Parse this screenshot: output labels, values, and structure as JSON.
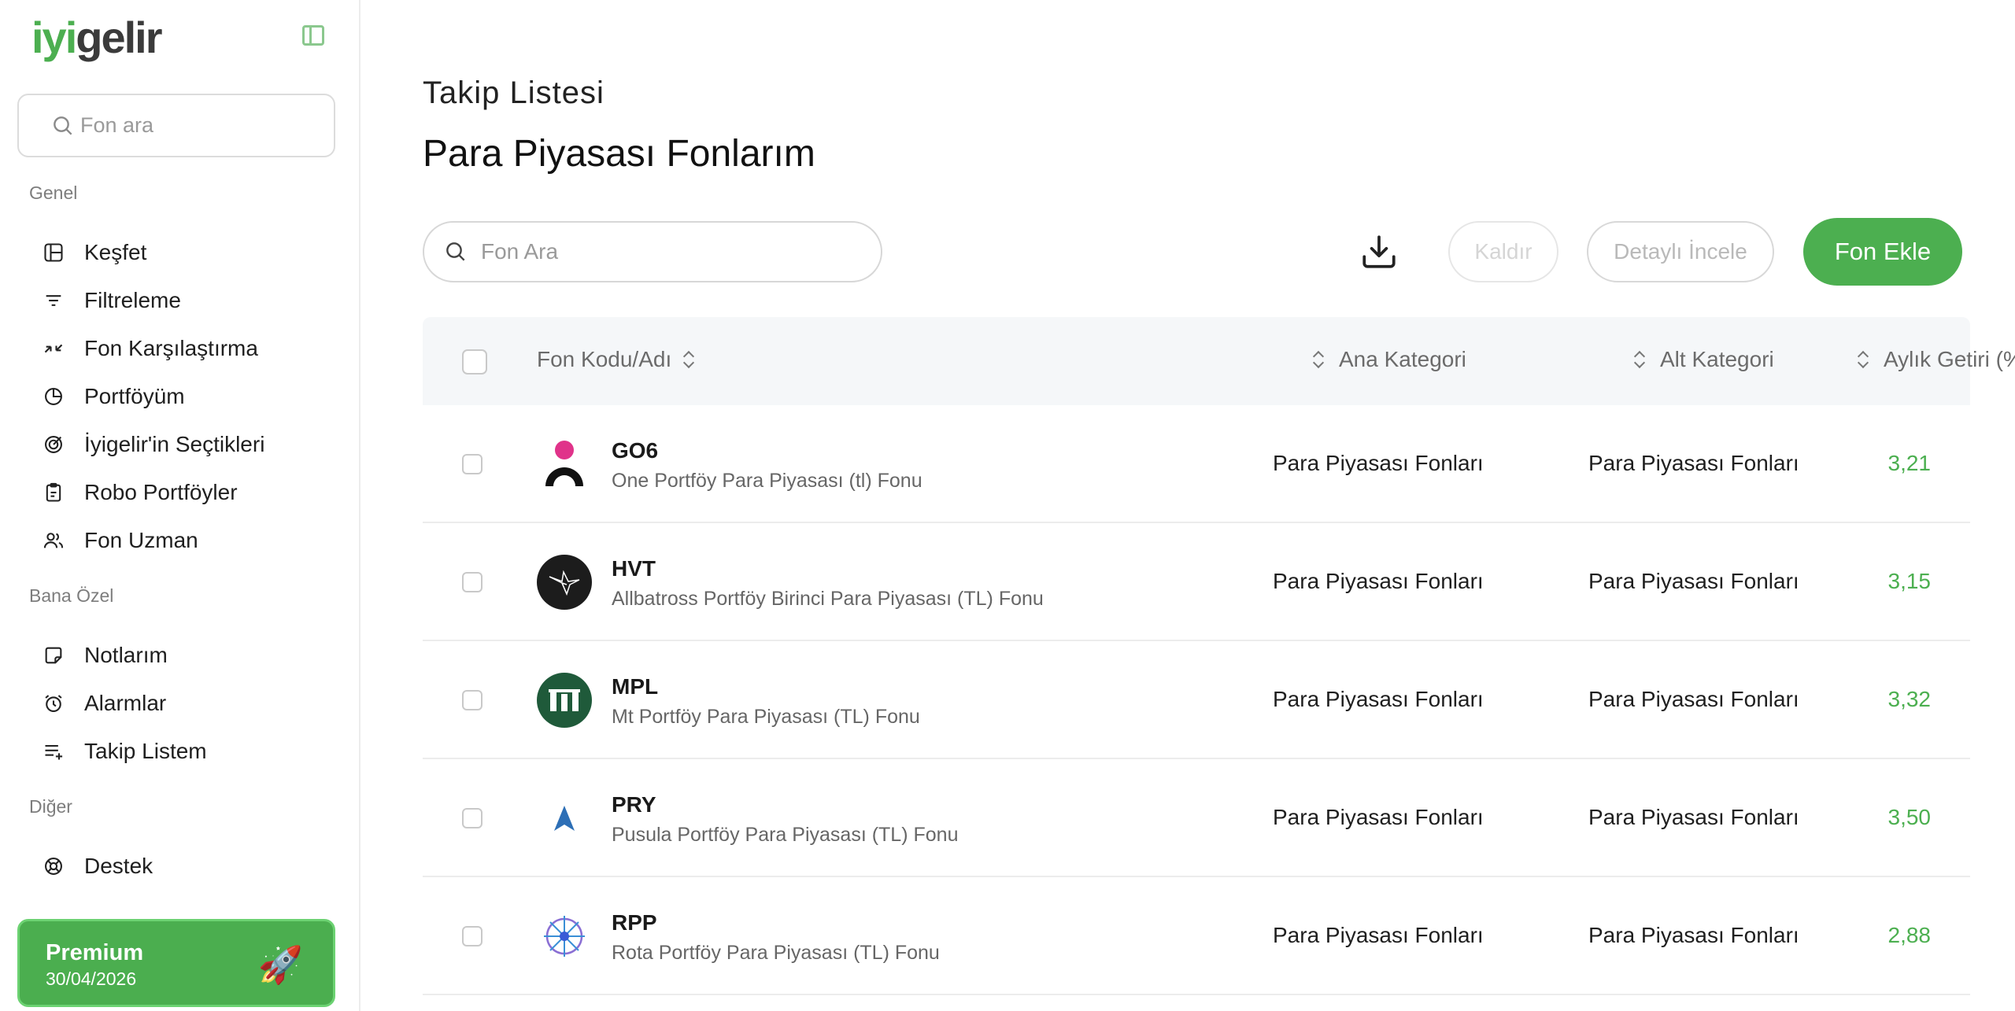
{
  "sidebar": {
    "logo": "iyigelir",
    "search_placeholder": "Fon ara",
    "sections": {
      "genel": "Genel",
      "bana_ozel": "Bana Özel",
      "diger": "Diğer"
    },
    "items": {
      "kesfet": "Keşfet",
      "filtreleme": "Filtreleme",
      "karsilastirma": "Fon Karşılaştırma",
      "portfoyum": "Portföyüm",
      "secimler": "İyigelir'in Seçtikleri",
      "robo": "Robo Portföyler",
      "uzman": "Fon Uzman",
      "notlarim": "Notlarım",
      "alarmlar": "Alarmlar",
      "takip": "Takip Listem",
      "destek": "Destek"
    },
    "premium": {
      "title": "Premium",
      "date": "30/04/2026",
      "icon": "rocket-icon"
    }
  },
  "page": {
    "subtitle": "Takip Listesi",
    "title": "Para Piyasası Fonlarım",
    "search_placeholder": "Fon Ara",
    "buttons": {
      "remove": "Kaldır",
      "detail": "Detaylı İncele",
      "add": "Fon Ekle"
    }
  },
  "table": {
    "headers": {
      "code": "Fon Kodu/Adı",
      "ana": "Ana Kategori",
      "alt": "Alt Kategori",
      "getiri": "Aylık Getiri (%)"
    },
    "rows": [
      {
        "code": "GO6",
        "name": "One Portföy Para Piyasası (tl) Fonu",
        "ana": "Para Piyasası Fonları",
        "alt": "Para Piyasası Fonları",
        "getiri": "3,21"
      },
      {
        "code": "HVT",
        "name": "Allbatross Portföy Birinci Para Piyasası (TL) Fonu",
        "ana": "Para Piyasası Fonları",
        "alt": "Para Piyasası Fonları",
        "getiri": "3,15"
      },
      {
        "code": "MPL",
        "name": "Mt Portföy Para Piyasası (TL) Fonu",
        "ana": "Para Piyasası Fonları",
        "alt": "Para Piyasası Fonları",
        "getiri": "3,32"
      },
      {
        "code": "PRY",
        "name": "Pusula Portföy Para Piyasası (TL) Fonu",
        "ana": "Para Piyasası Fonları",
        "alt": "Para Piyasası Fonları",
        "getiri": "3,50"
      },
      {
        "code": "RPP",
        "name": "Rota Portföy Para Piyasası (TL) Fonu",
        "ana": "Para Piyasası Fonları",
        "alt": "Para Piyasası Fonları",
        "getiri": "2,88"
      }
    ]
  },
  "colors": {
    "accent": "#4caf50",
    "positive": "#4caf50"
  }
}
